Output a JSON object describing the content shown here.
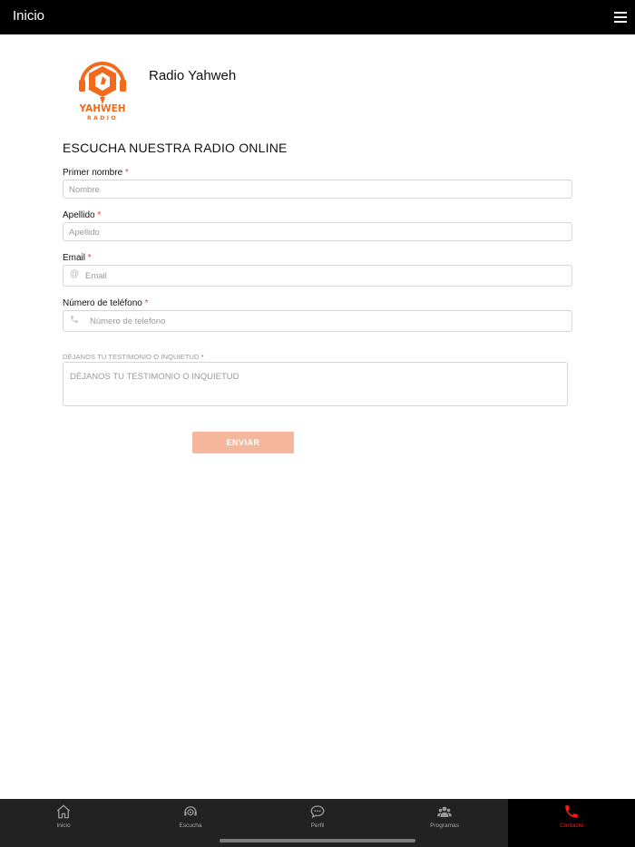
{
  "header": {
    "title": "Inicio",
    "menu_icon": "hamburger-menu-icon"
  },
  "brand": {
    "name": "Radio Yahweh",
    "logo_text_top": "YAHWEH",
    "logo_text_bottom": "RADIO",
    "logo_color": "#f26a1b"
  },
  "section_title": "ESCUCHA NUESTRA RADIO ONLINE",
  "form": {
    "required_mark": "*",
    "first_name": {
      "label": "Primer nombre",
      "placeholder": "Nombre"
    },
    "last_name": {
      "label": "Apellido",
      "placeholder": "Apellido"
    },
    "email": {
      "label": "Email",
      "placeholder": "Email",
      "icon": "at-icon",
      "icon_glyph": "@"
    },
    "phone": {
      "label": "Número de teléfono",
      "placeholder": "Número de telefono",
      "icon": "phone-icon"
    },
    "message": {
      "label": "DÉJANOS TU TESTIMONIO O INQUIETUD",
      "placeholder": "DÉJANOS TU TESTIMONIO O INQUIETUD"
    },
    "submit_label": "ENVIAR",
    "submit_color": "#f5b79c"
  },
  "tabs": [
    {
      "label": "Inicio",
      "icon": "home-icon"
    },
    {
      "label": "Escucha",
      "icon": "radio-headset-icon"
    },
    {
      "label": "Perfil",
      "icon": "chat-bubble-icon"
    },
    {
      "label": "Programas",
      "icon": "group-icon"
    },
    {
      "label": "Contacto",
      "icon": "phone-icon",
      "active": true
    }
  ],
  "colors": {
    "accent": "#ff1a1a",
    "tabbar": "#222222",
    "topbar": "#000000"
  }
}
